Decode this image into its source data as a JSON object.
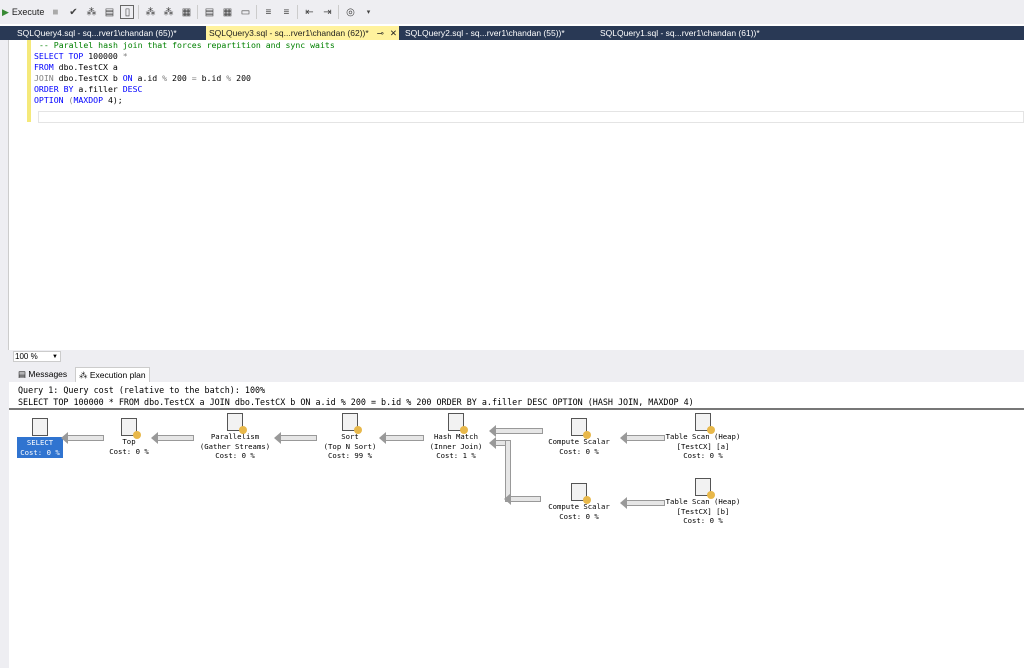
{
  "toolbar": {
    "execute_label": "Execute",
    "icons": [
      "stop-icon",
      "parse-icon",
      "display-plan-icon",
      "results-to-grid-icon",
      "results-to-text-icon",
      "include-plan-icon",
      "comment-icon",
      "uncomment-icon",
      "indent-icon",
      "outdent-icon",
      "intellisense-icon"
    ]
  },
  "tabs": [
    {
      "label": "SQLQuery4.sql - sq...rver1\\chandan (65))*",
      "active": false
    },
    {
      "label": "SQLQuery3.sql - sq...rver1\\chandan (62))*",
      "active": true
    },
    {
      "label": "SQLQuery2.sql - sq...rver1\\chandan (55))*",
      "active": false
    },
    {
      "label": "SQLQuery1.sql - sq...rver1\\chandan (61))*",
      "active": false
    }
  ],
  "editor": {
    "comment": "-- Parallel hash join that forces repartition and sync waits",
    "lines": [
      [
        "SELECT TOP",
        " 100000 ",
        "*"
      ],
      [
        "FROM",
        " dbo.TestCX a"
      ],
      [
        "JOIN",
        " dbo.TestCX b ",
        "ON",
        " a.id ",
        "%",
        " 200 ",
        "=",
        " b.id ",
        "%",
        " 200"
      ],
      [
        "ORDER BY",
        " a.filler ",
        "DESC"
      ],
      [
        "OPTION",
        " (",
        "MAXDOP",
        " 4);"
      ]
    ]
  },
  "zoom": {
    "value": "100 %"
  },
  "results_tabs": [
    {
      "label": "Messages"
    },
    {
      "label": "Execution plan"
    }
  ],
  "plan": {
    "header": "Query 1: Query cost (relative to the batch): 100%",
    "query": "SELECT TOP 100000 * FROM dbo.TestCX a JOIN dbo.TestCX b ON a.id % 200 = b.id % 200 ORDER BY a.filler DESC OPTION (HASH JOIN, MAXDOP 4)",
    "nodes": [
      {
        "name": "SELECT",
        "line2": "",
        "cost": "Cost: 0 %"
      },
      {
        "name": "Top",
        "line2": "",
        "cost": "Cost: 0 %"
      },
      {
        "name": "Parallelism",
        "line2": "(Gather Streams)",
        "cost": "Cost: 0 %"
      },
      {
        "name": "Sort",
        "line2": "(Top N Sort)",
        "cost": "Cost: 99 %"
      },
      {
        "name": "Hash Match",
        "line2": "(Inner Join)",
        "cost": "Cost: 1 %"
      },
      {
        "name": "Compute Scalar",
        "line2": "",
        "cost": "Cost: 0 %"
      },
      {
        "name": "Table Scan (Heap)",
        "line2": "[TestCX] [a]",
        "cost": "Cost: 0 %"
      },
      {
        "name": "Compute Scalar",
        "line2": "",
        "cost": "Cost: 0 %"
      },
      {
        "name": "Table Scan (Heap)",
        "line2": "[TestCX] [b]",
        "cost": "Cost: 0 %"
      }
    ]
  }
}
